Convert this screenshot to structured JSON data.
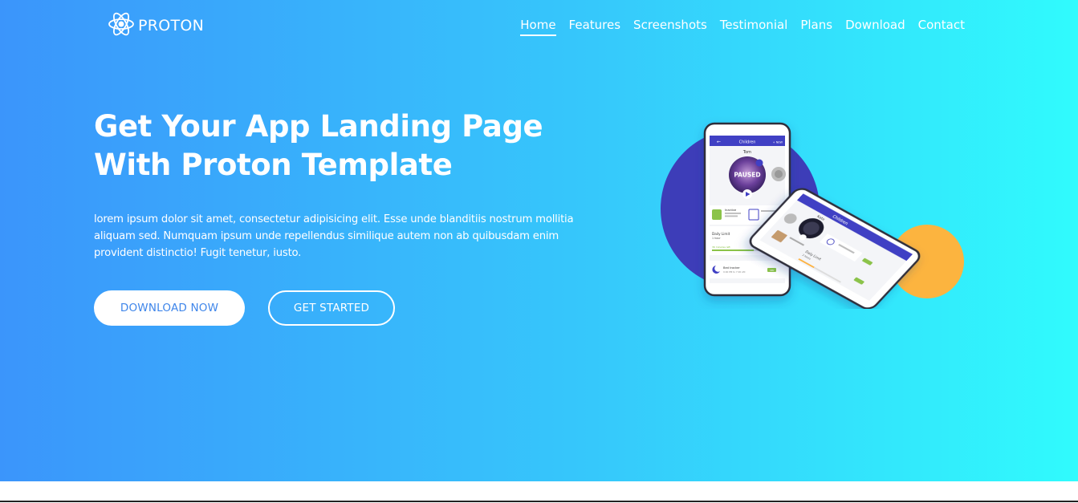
{
  "brand": {
    "name": "PROTON",
    "icon": "atom-icon"
  },
  "nav": {
    "items": [
      {
        "label": "Home",
        "active": true
      },
      {
        "label": "Features",
        "active": false
      },
      {
        "label": "Screenshots",
        "active": false
      },
      {
        "label": "Testimonial",
        "active": false
      },
      {
        "label": "Plans",
        "active": false
      },
      {
        "label": "Download",
        "active": false
      },
      {
        "label": "Contact",
        "active": false
      }
    ]
  },
  "hero": {
    "title_line1": "Get Your App Landing Page",
    "title_line2": "With Proton Template",
    "text": "lorem ipsum dolor sit amet, consectetur adipisicing elit. Esse unde blanditiis nostrum mollitia aliquam sed. Numquam ipsum unde repellendus similique autem non ab quibusdam enim provident distinctio! Fugit tenetur, iusto.",
    "download_label": "DOWNLOAD NOW",
    "start_label": "GET STARTED"
  },
  "phone_front": {
    "header": "Children",
    "header_action": "+ NEW",
    "name": "Tom",
    "status": "PAUSED",
    "card_title": "Inactive",
    "limit_title": "Daily Limit",
    "limit_value": "1 hour",
    "remaining": "36 minutes left",
    "bedtime": "Bed tracker",
    "bedtime_time": "9:00 PM to 7:00 AM",
    "toggle": "ON"
  },
  "phone_back": {
    "header": "Children",
    "name": "Kate",
    "limit_title": "Daily Limit",
    "limit_value": "2 hours"
  },
  "colors": {
    "gradient_start": "#3b95fb",
    "gradient_end": "#30fbfd",
    "circle_purple": "#3d3db8",
    "circle_orange": "#fcb43f",
    "app_bar": "#4040c4",
    "button_text": "#3f86ea"
  }
}
